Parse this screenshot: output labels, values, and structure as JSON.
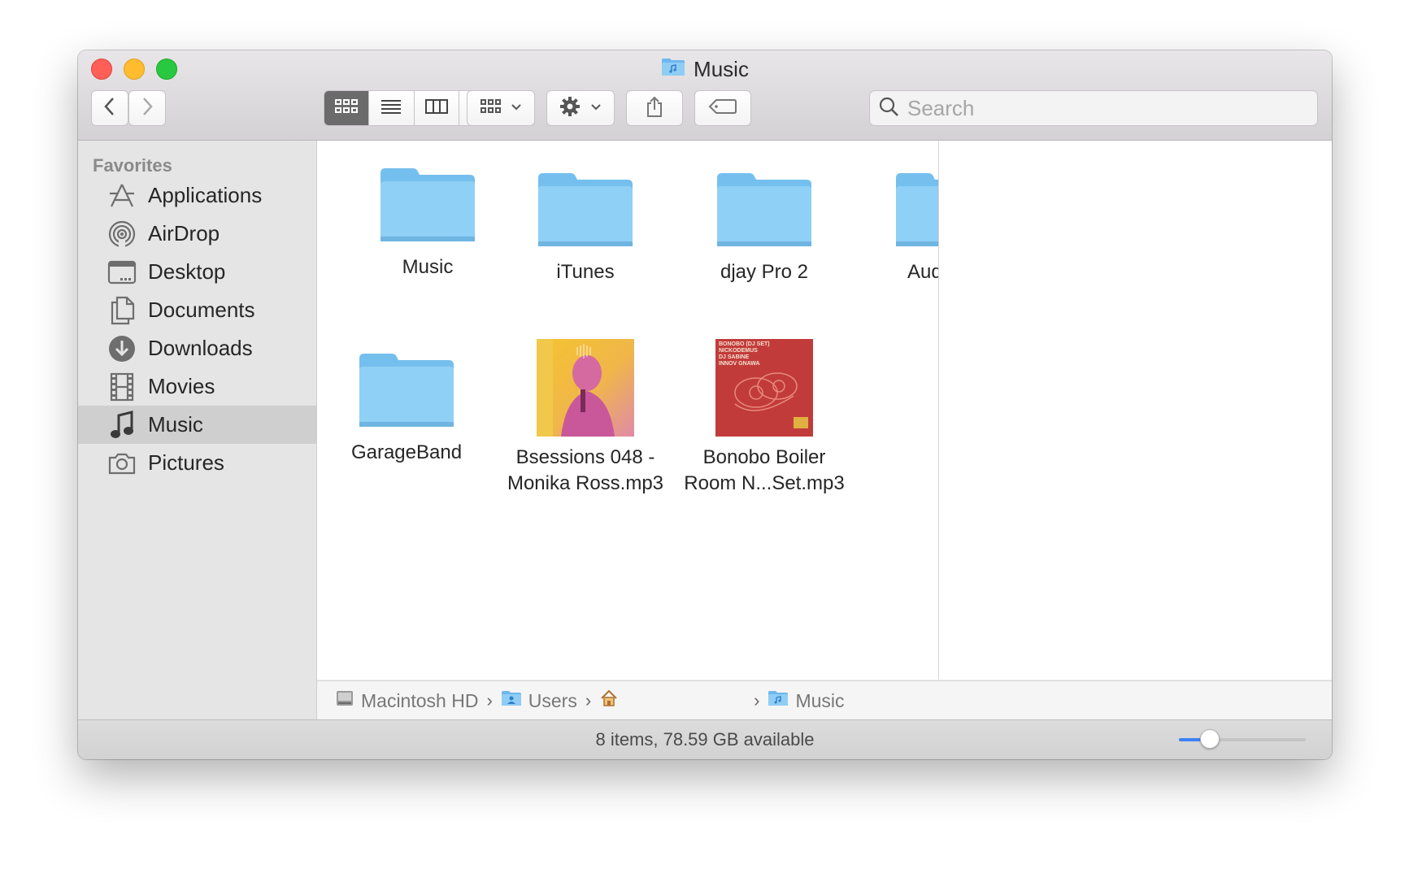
{
  "window": {
    "title": "Music",
    "title_icon": "music-folder-icon"
  },
  "toolbar": {
    "back_icon": "chevron-left-icon",
    "forward_icon": "chevron-right-icon",
    "view_modes": [
      "icon-view",
      "list-view",
      "column-view",
      "gallery-view"
    ],
    "active_view": "icon-view",
    "group_icon": "group-icon",
    "action_icon": "gear-icon",
    "share_icon": "share-icon",
    "tag_icon": "tag-icon",
    "search_placeholder": "Search"
  },
  "sidebar": {
    "heading": "Favorites",
    "items": [
      {
        "label": "Applications",
        "icon": "applications-icon"
      },
      {
        "label": "AirDrop",
        "icon": "airdrop-icon"
      },
      {
        "label": "Desktop",
        "icon": "desktop-icon"
      },
      {
        "label": "Documents",
        "icon": "documents-icon"
      },
      {
        "label": "Downloads",
        "icon": "downloads-icon"
      },
      {
        "label": "Movies",
        "icon": "movies-icon"
      },
      {
        "label": "Music",
        "icon": "music-icon",
        "selected": true
      },
      {
        "label": "Pictures",
        "icon": "pictures-icon"
      }
    ]
  },
  "files": [
    {
      "label": "Music",
      "kind": "folder"
    },
    {
      "label": "iTunes",
      "kind": "folder"
    },
    {
      "label": "djay Pro 2",
      "kind": "folder"
    },
    {
      "label": "Audio M",
      "kind": "folder"
    },
    {
      "label": "GarageBand",
      "kind": "folder"
    },
    {
      "label": "Bsessions 048 -",
      "label2": "Monika Ross.mp3",
      "kind": "mp3"
    },
    {
      "label": "Bonobo Boiler",
      "label2": "Room N...Set.mp3",
      "kind": "mp3",
      "artwork_text": [
        "BONOBO (DJ SET)",
        "NICKODEMUS",
        "DJ SABINE",
        "INNOV GNAWA"
      ]
    }
  ],
  "pathbar": {
    "items": [
      {
        "label": "Macintosh HD",
        "icon": "hard-drive-icon"
      },
      {
        "label": "Users",
        "icon": "users-folder-icon"
      },
      {
        "label": "",
        "icon": "home-icon"
      },
      {
        "label": "Music",
        "icon": "music-folder-icon"
      }
    ]
  },
  "status": {
    "text": "8 items, 78.59 GB available",
    "zoom_level": 0.24
  },
  "colors": {
    "accent": "#3b82f6",
    "folder": "#8ccbf3",
    "selection": "#d0cfd0"
  }
}
